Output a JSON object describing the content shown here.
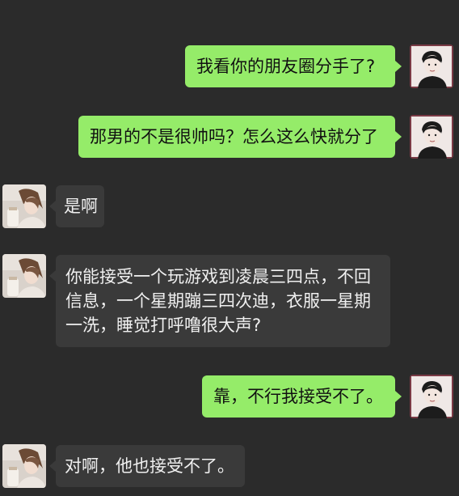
{
  "messages": [
    {
      "sender": "me",
      "text": "我看你的朋友圈分手了?"
    },
    {
      "sender": "me",
      "text": "那男的不是很帅吗？怎么这么快就分了"
    },
    {
      "sender": "other",
      "text": "是啊"
    },
    {
      "sender": "other",
      "lines": [
        "你能接受一个玩游戏到凌晨三四点，不回",
        "信息，一个星期蹦三四次迪，衣服一星期",
        "一洗，睡觉打呼噜很大声?"
      ]
    },
    {
      "sender": "me",
      "text": "靠，不行我接受不了。"
    },
    {
      "sender": "other",
      "text": "对啊，他也接受不了。"
    }
  ],
  "colors": {
    "background": "#2b2b2b",
    "my_bubble": "#95ec69",
    "other_bubble": "#3a3a3a",
    "other_text": "#f0f0f0"
  },
  "avatars": {
    "me": "male-avatar-icon",
    "other": "female-avatar-icon"
  }
}
